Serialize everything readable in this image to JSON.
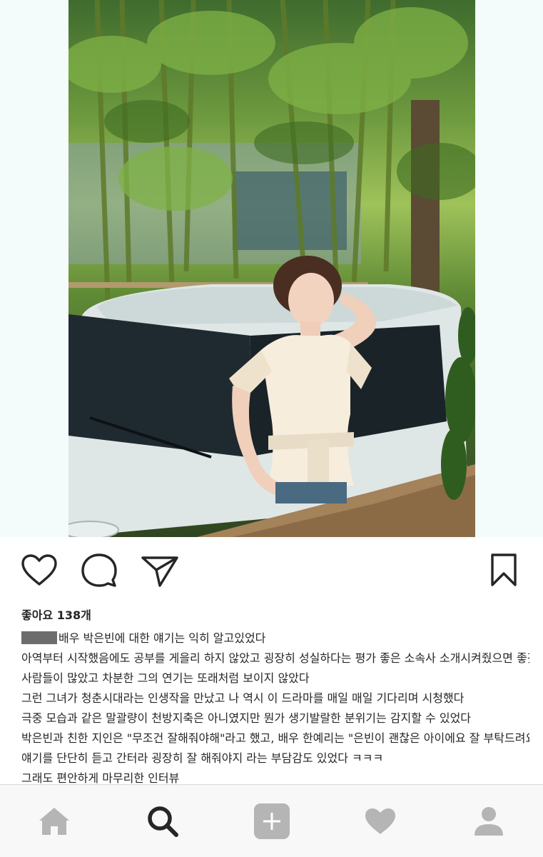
{
  "post": {
    "likes_text": "좋아요 138개",
    "caption_lines": [
      "배우 박은빈에 대한 얘기는 익히 알고있었다",
      "아역부터 시작했음에도 공부를 게을리 하지 않았고 굉장히 성실하다는 평가 좋은 소속사 소개시켜줬으면 좋겠다는",
      "사람들이 많았고 차분한 그의 연기는 또래처럼 보이지 않았다",
      "그런 그녀가 청춘시대라는 인생작을 만났고 나 역시 이 드라마를 매일 매일 기다리며 시청했다",
      "극중 모습과 같은 말괄량이 천방지축은 아니였지만 뭔가 생기발랄한 분위기는 감지할 수 있었다",
      "박은빈과 친한 지인은 \"무조건 잘해줘야해\"라고 했고, 배우 한예리는 \"은빈이 괜찮은 아이에요 잘 부탁드려요\"라는",
      "얘기를 단단히 듣고 간터라 굉장히 잘 해줘야지 라는 부담감도 있었다 ㅋㅋㅋ"
    ],
    "cutoff_line": "그래도 편안하게 마무리한 인터뷰"
  },
  "actions": {
    "like_icon": "heart-outline-icon",
    "comment_icon": "comment-bubble-icon",
    "share_icon": "paper-plane-icon",
    "save_icon": "bookmark-icon"
  },
  "tabbar": {
    "items": [
      "home-icon",
      "search-icon",
      "add-icon",
      "heart-icon",
      "profile-icon"
    ],
    "active_color": "#262626",
    "inactive_color": "#b5b5b5"
  }
}
